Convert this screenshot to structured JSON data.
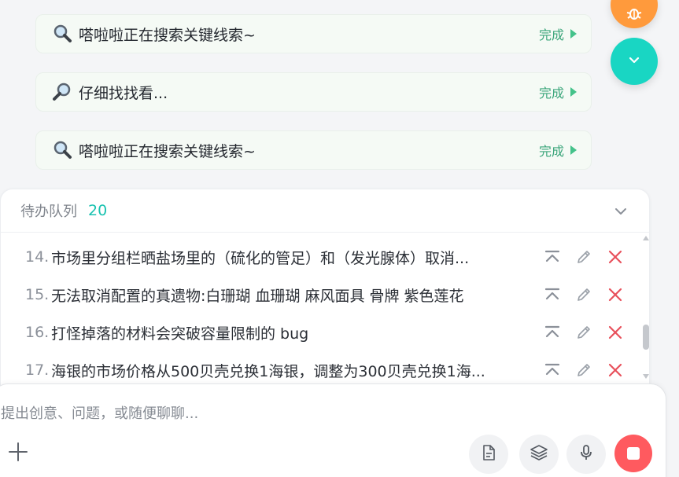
{
  "status_items": [
    {
      "emoji": "magnifier-left-icon",
      "text": "嗒啦啦正在搜索关键线索~",
      "status": "完成"
    },
    {
      "emoji": "magnifier-right-icon",
      "text": "仔细找找看...",
      "status": "完成"
    },
    {
      "emoji": "magnifier-left-icon",
      "text": "嗒啦啦正在搜索关键线索~",
      "status": "完成"
    }
  ],
  "queue": {
    "title": "待办队列",
    "count": "20",
    "items": [
      {
        "num": "14.",
        "text": "市场里分组栏晒盐场里的（硫化的管足）和（发光腺体）取消..."
      },
      {
        "num": "15.",
        "text": "无法取消配置的真遗物:白珊瑚 血珊瑚 麻风面具 骨牌 紫色莲花"
      },
      {
        "num": "16.",
        "text": "打怪掉落的材料会突破容量限制的 bug"
      },
      {
        "num": "17.",
        "text": "海银的市场价格从500贝壳兑换1海银，调整为300贝壳兑换1海..."
      }
    ]
  },
  "composer": {
    "placeholder": "提出创意、问题，或随便聊聊..."
  },
  "colors": {
    "accent_teal": "#19d6c3",
    "bug_orange": "#ff9a3c",
    "done_green": "#3aa57a",
    "stop_red": "#ff5a5f",
    "delete_red": "#e8505b"
  }
}
